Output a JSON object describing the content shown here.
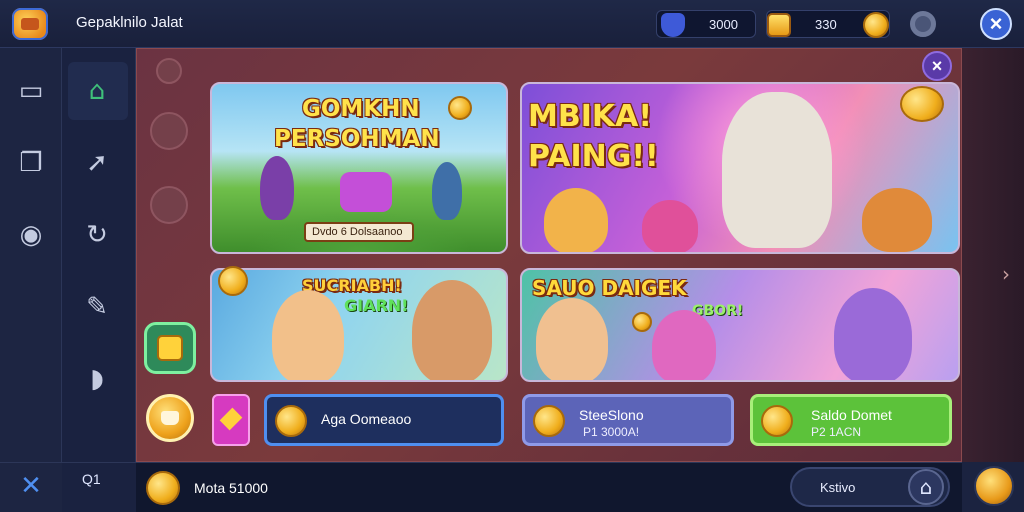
{
  "header": {
    "title": "Gepaklnilo Jalat",
    "resource_a_value": "3000",
    "resource_b_value": "330"
  },
  "icons": {
    "app": "app-chest-icon",
    "rail": [
      "document-icon",
      "copy-icon",
      "eye-icon",
      "home-icon",
      "rocket-icon",
      "refresh-icon",
      "pen-icon",
      "bell-icon",
      "profile-icon",
      "tag-icon",
      "box-icon"
    ]
  },
  "cards": {
    "card1": {
      "line1": "GOMKHN",
      "line2": "PERSOHMAN",
      "tag": "Dvdo  6 Dolsaanoo"
    },
    "card2": {
      "line1": "MBIKA!",
      "line2": "PAING!!"
    },
    "card3": {
      "line1": "SUCRIABH!",
      "line2": "GIARN!"
    },
    "card4": {
      "line1": "SAUO DAIGEK",
      "line2": "GBOR!"
    }
  },
  "actions": [
    {
      "label": "Aga Oomeaoo",
      "sub": ""
    },
    {
      "label": "SteeSlono",
      "sub": "P1 3000A!"
    },
    {
      "label": "Saldo Domet",
      "sub": "P2 1ACN"
    }
  ],
  "bottom": {
    "balance": "Mota 51000",
    "home_label": "Kstivo",
    "corner_label": "Q1"
  },
  "colors": {
    "accent": "#3a63d4",
    "panel": "#6b3342",
    "action_green": "#5cc23a",
    "action_blue": "#5c64b8",
    "coin": "#f0ae1c"
  }
}
